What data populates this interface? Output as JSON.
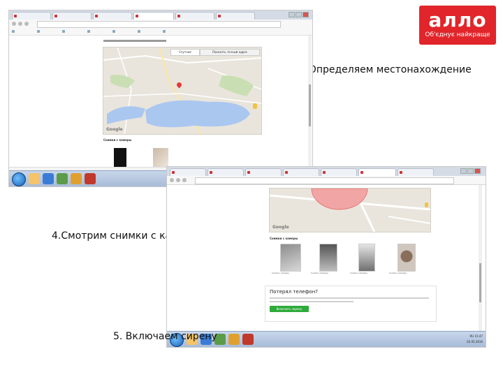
{
  "logo": {
    "word": "алло",
    "tagline": "Об'єднує найкраще",
    "brand_color": "#e1252a"
  },
  "captions": {
    "step3": "3. Определяем местонахождение",
    "step4": "4.Смотрим снимки с камеры",
    "step5": "5. Включаем сирену"
  },
  "screenshot1": {
    "map_tabs": [
      "Спутник",
      "Показать точный адрес"
    ],
    "map_footer": "Google",
    "photos_heading": "Снимки с камеры"
  },
  "screenshot2": {
    "map_footer": "Google",
    "photos_heading": "Снимки с камеры",
    "thumbnails": [
      {
        "caption": "Снимок камеры"
      },
      {
        "caption": "Снимок камеры"
      },
      {
        "caption": "Снимок камеры"
      },
      {
        "caption": "Снимок камеры"
      }
    ],
    "card": {
      "title": "Потерял телефон?",
      "button": "Включить сирену"
    }
  },
  "taskbar": {
    "language": "RU",
    "time": "15:47",
    "date": "02.05.2016"
  }
}
